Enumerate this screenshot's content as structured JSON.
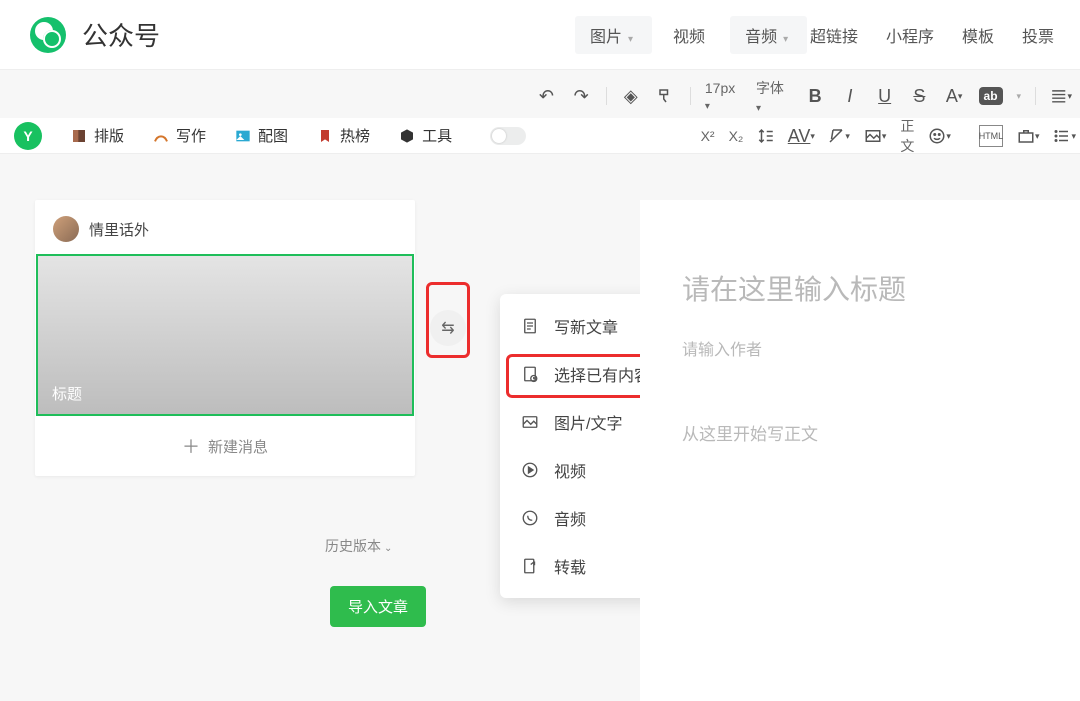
{
  "header": {
    "title": "公众号",
    "tabs": [
      {
        "label": "图片",
        "caret": true
      },
      {
        "label": "视频",
        "caret": false
      },
      {
        "label": "音频",
        "caret": true
      }
    ],
    "right": [
      "超链接",
      "小程序",
      "模板",
      "投票"
    ]
  },
  "toolbar_row1": {
    "font_size": "17px",
    "font_family": "字体",
    "ab_label": "ab"
  },
  "toolbar_row2": {
    "zhengwen": "正文",
    "x_sup": "X²",
    "x_sub": "X₂"
  },
  "secondary_nav": [
    "排版",
    "写作",
    "配图",
    "热榜",
    "工具"
  ],
  "left": {
    "author": "情里话外",
    "thumb_label": "标题",
    "new_msg": "新建消息",
    "history": "历史版本",
    "import": "导入文章"
  },
  "menu": [
    {
      "label": "写新文章",
      "icon": "doc"
    },
    {
      "label": "选择已有内容",
      "icon": "doc-time"
    },
    {
      "label": "图片/文字",
      "icon": "image"
    },
    {
      "label": "视频",
      "icon": "play"
    },
    {
      "label": "音频",
      "icon": "audio"
    },
    {
      "label": "转载",
      "icon": "share"
    }
  ],
  "editor": {
    "title_placeholder": "请在这里输入标题",
    "author_placeholder": "请输入作者",
    "body_placeholder": "从这里开始写正文"
  }
}
